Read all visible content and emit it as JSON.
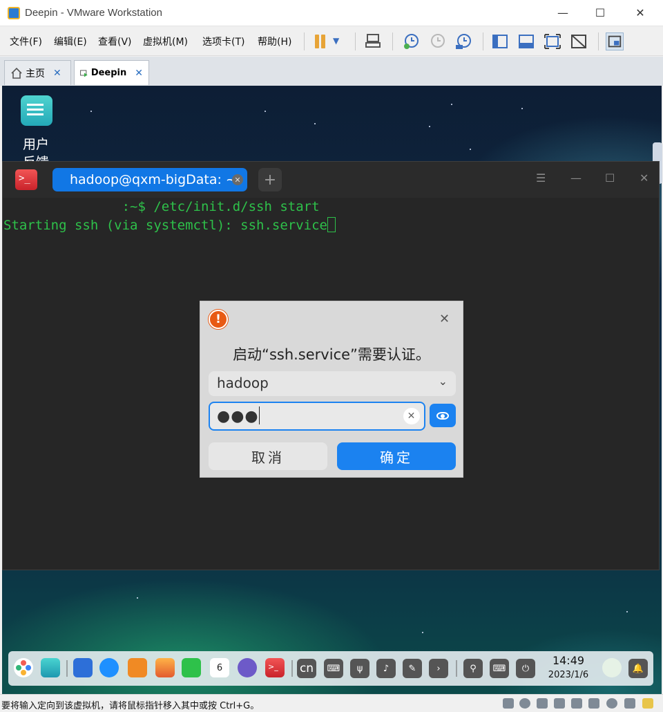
{
  "window": {
    "title": "Deepin - VMware Workstation"
  },
  "menu": [
    "文件(F)",
    "编辑(E)",
    "查看(V)",
    "虚拟机(M)",
    "选项卡(T)",
    "帮助(H)"
  ],
  "tabs": [
    {
      "label": "主页",
      "icon": "home-icon"
    },
    {
      "label": "Deepin",
      "icon": "vm-play-icon"
    }
  ],
  "desktop": {
    "icon_label": "用户反馈"
  },
  "terminal": {
    "tab_title": "hadoop@qxm-bigData: ~",
    "lines": [
      "               :~$ /etc/init.d/ssh start",
      "Starting ssh (via systemctl): ssh.service"
    ],
    "text_color": "#2ec14a"
  },
  "auth_dialog": {
    "message": "启动“ssh.service”需要认证。",
    "user": "hadoop",
    "password_mask": "●●●",
    "cancel_label": "取消",
    "ok_label": "确定",
    "accent": "#1b82f0"
  },
  "dock": {
    "time": "14:49",
    "date": "2023/1/6",
    "ime": "cn",
    "calendar_day": "6"
  },
  "statusbar": {
    "text": "要将输入定向到该虚拟机，请将鼠标指针移入其中或按 Ctrl+G。"
  }
}
